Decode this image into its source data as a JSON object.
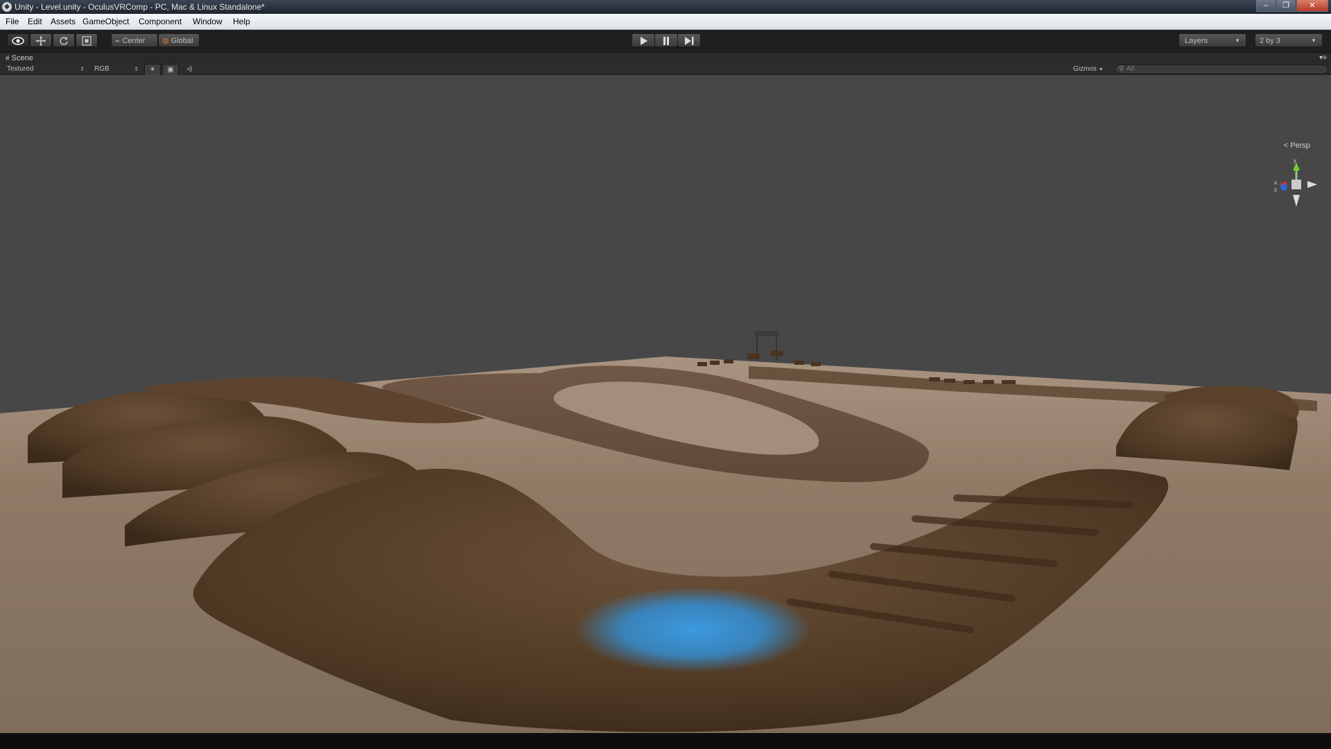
{
  "window": {
    "title": "Unity - Level.unity - OculusVRComp - PC, Mac & Linux Standalone*",
    "icon": "unity-icon"
  },
  "menu": [
    "File",
    "Edit",
    "Assets",
    "GameObject",
    "Component",
    "Window",
    "Help"
  ],
  "toolbar": {
    "tools": [
      "hand-icon",
      "move-icon",
      "rotate-icon",
      "scale-icon"
    ],
    "pivot_center": "Center",
    "pivot_global": "Global",
    "layers_label": "Layers",
    "layout_label": "2 by 3"
  },
  "scene": {
    "tab_label": "Scene",
    "render_mode": "Textured",
    "color_mode": "RGB",
    "gizmos_label": "Gizmos",
    "search_placeholder": "All",
    "projection": "Persp",
    "axis_y": "y",
    "axis_x": "x",
    "axis_z": "z"
  },
  "colors": {
    "sky": "#474747",
    "ground": "#8a7560",
    "dirt_dark": "#5a4129",
    "water": "#3a8fd0",
    "toolbar": "#1f1f1f"
  }
}
